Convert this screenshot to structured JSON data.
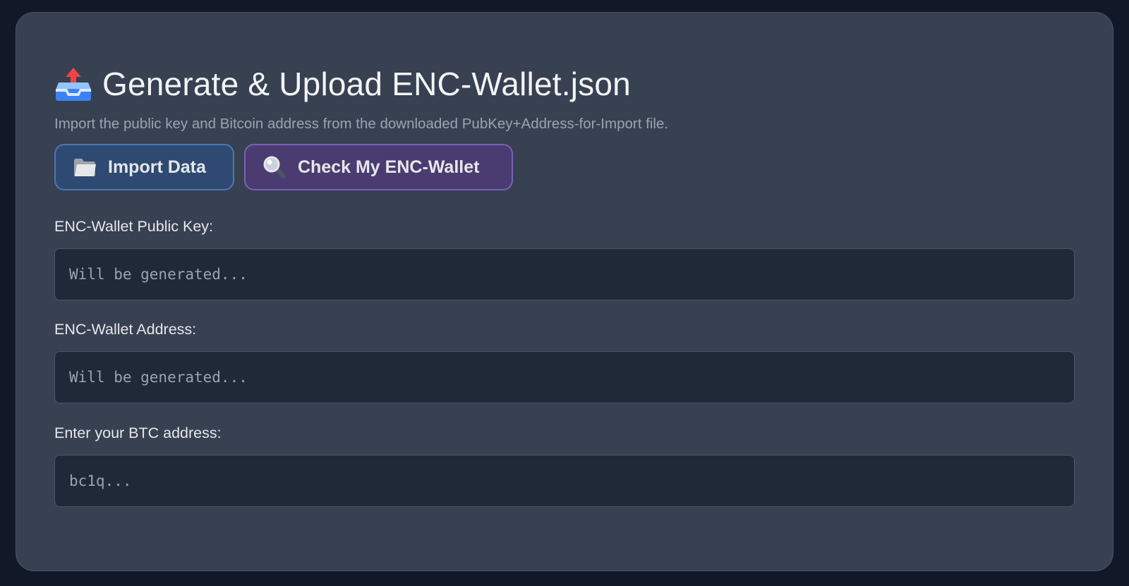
{
  "card": {
    "icon": "outbox-tray-icon",
    "title": "Generate & Upload ENC-Wallet.json",
    "subtitle": "Import the public key and Bitcoin address from the downloaded PubKey+Address-for-Import file."
  },
  "buttons": {
    "import": {
      "icon": "folder-icon",
      "label": "Import Data"
    },
    "check": {
      "icon": "magnifying-glass-icon",
      "label": "Check My ENC-Wallet"
    }
  },
  "fields": {
    "public_key": {
      "label": "ENC-Wallet Public Key:",
      "placeholder": "Will be generated...",
      "value": ""
    },
    "address": {
      "label": "ENC-Wallet Address:",
      "placeholder": "Will be generated...",
      "value": ""
    },
    "btc_address": {
      "label": "Enter your BTC address:",
      "placeholder": "bc1q...",
      "value": ""
    }
  },
  "colors": {
    "page_background": "#111827",
    "card_background": "#374151",
    "input_background": "#1f2937",
    "import_button": "#2f4a72",
    "check_button": "#4a3c70"
  }
}
